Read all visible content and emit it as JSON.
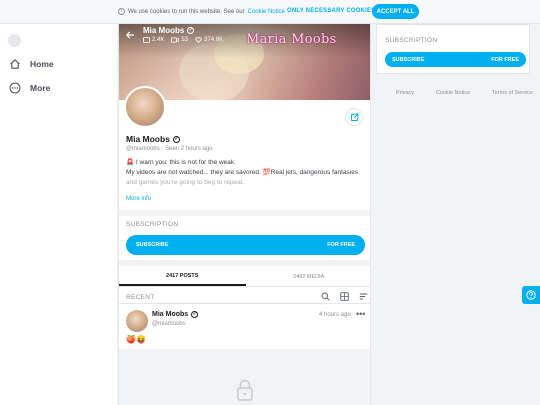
{
  "cookie": {
    "message": "We use cookies to run this website. See our",
    "link": "Cookie Notice",
    "link_suffix": ".",
    "necessary": "ONLY NECESSARY COOKIES",
    "accept": "ACCEPT ALL"
  },
  "nav": {
    "items": [
      {
        "label": "Home",
        "icon": "home-icon"
      },
      {
        "label": "More",
        "icon": "more-circle-icon"
      }
    ]
  },
  "profile": {
    "banner_name": "Mia Moobs",
    "stats": {
      "photos": "2.4K",
      "videos": "53",
      "likes": "374.8K"
    },
    "watermark": "Maria Moobs",
    "name": "Mia Moobs",
    "handle": "@miamoobs",
    "seen": "Seen  2 hours ago",
    "bio_line1": "🚨 I warn you: this is not for the weak.",
    "bio_line2": "My videos are not watched... they are savored. 💯Real jets, dangerous fantasies",
    "bio_line3": "and games you're going to beg to repeat.",
    "more_info": "More info"
  },
  "subscription": {
    "label": "SUBSCRIPTION",
    "button_left": "SUBSCRIBE",
    "button_right": "FOR FREE"
  },
  "tabs": [
    {
      "label": "2417 POSTS",
      "active": true
    },
    {
      "label": "2482 MEDIA",
      "active": false
    }
  ],
  "feed": {
    "label": "RECENT",
    "post": {
      "name": "Mia Moobs",
      "handle": "@miamoobs",
      "time": "4 hours ago",
      "more": "•••",
      "text": "🍑😝"
    }
  },
  "right": {
    "label": "SUBSCRIPTION",
    "button_left": "SUBSCRIBE",
    "button_right": "FOR FREE",
    "footer": [
      "Privacy",
      "Cookie Notice",
      "Terms of Service"
    ]
  },
  "colors": {
    "accent": "#00aff0",
    "text": "#1a1a1a",
    "muted": "#8a9096"
  }
}
